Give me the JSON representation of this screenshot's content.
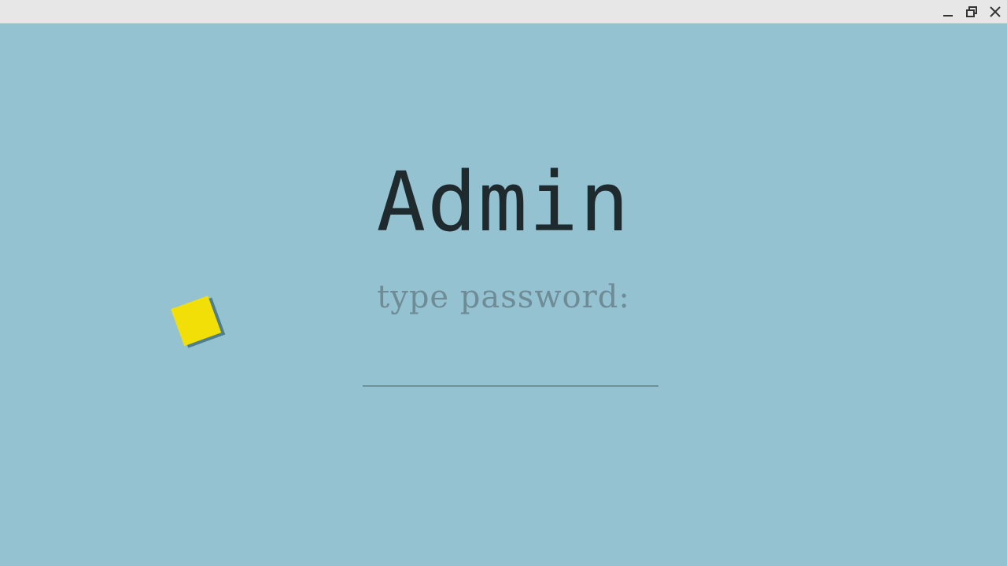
{
  "window": {
    "controls": [
      "minimize-icon",
      "restore-icon",
      "close-icon"
    ]
  },
  "login": {
    "title": "Admin",
    "prompt": "type password:",
    "password_value": ""
  },
  "decoration": {
    "sticker_icon": "yellow-square-icon",
    "sticker_color": "#f2df07",
    "background_color": "#94c2d1"
  }
}
